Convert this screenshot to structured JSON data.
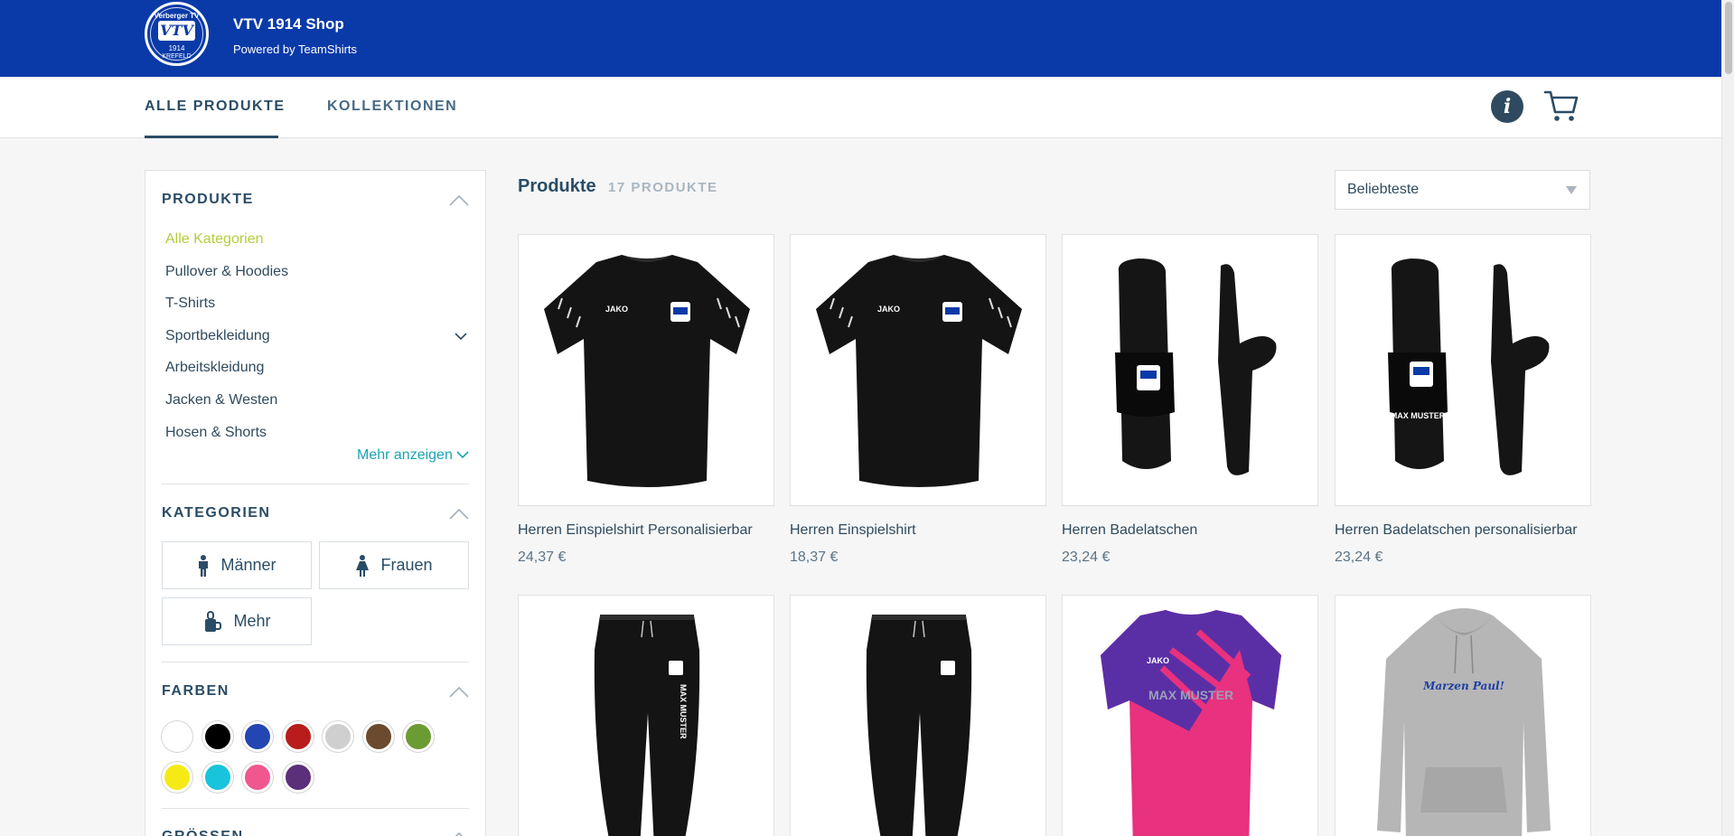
{
  "header": {
    "shop_title": "VTV 1914 Shop",
    "shop_subtitle": "Powered by TeamShirts",
    "logo": {
      "top_text": "Verberger TV",
      "mark": "VTV",
      "year": "1914",
      "city": "KREFELD"
    },
    "brand_color": "#0a3aa8"
  },
  "nav": {
    "tabs": [
      {
        "label": "ALLE PRODUKTE",
        "active": true
      },
      {
        "label": "KOLLEKTIONEN",
        "active": false
      }
    ],
    "icons": [
      "info-icon",
      "cart-icon"
    ]
  },
  "sidebar": {
    "produkte": {
      "title": "PRODUKTE",
      "items": [
        {
          "label": "Alle Kategorien",
          "active": true
        },
        {
          "label": "Pullover & Hoodies"
        },
        {
          "label": "T-Shirts"
        },
        {
          "label": "Sportbekleidung",
          "has_submenu": true
        },
        {
          "label": "Arbeitskleidung"
        },
        {
          "label": "Jacken & Westen"
        },
        {
          "label": "Hosen & Shorts"
        }
      ],
      "more_label": "Mehr anzeigen"
    },
    "kategorien": {
      "title": "KATEGORIEN",
      "buttons": [
        {
          "label": "Männer",
          "icon": "male-icon"
        },
        {
          "label": "Frauen",
          "icon": "female-icon"
        },
        {
          "label": "Mehr",
          "icon": "accessories-icon"
        }
      ]
    },
    "farben": {
      "title": "FARBEN",
      "swatches": [
        "#ffffff",
        "#000000",
        "#2346b2",
        "#b81c1c",
        "#cfcfcf",
        "#6b4a2e",
        "#6b9b33",
        "#f5ea16",
        "#18c3dc",
        "#f0578f",
        "#5b2f7a"
      ]
    },
    "groessen": {
      "title": "GRÖSSEN"
    }
  },
  "main": {
    "title": "Produkte",
    "count": "17 PRODUKTE",
    "sort": {
      "selected": "Beliebteste"
    },
    "products": [
      {
        "name": "Herren Einspielshirt Personalisierbar",
        "price": "24,37 €",
        "image": "black-jersey"
      },
      {
        "name": "Herren Einspielshirt",
        "price": "18,37 €",
        "image": "black-jersey"
      },
      {
        "name": "Herren Badelatschen",
        "price": "23,24 €",
        "image": "black-slides"
      },
      {
        "name": "Herren Badelatschen personalisierbar",
        "price": "23,24 €",
        "image": "black-slides-name",
        "print_text": "MAX MUSTER"
      },
      {
        "name": "",
        "price": "",
        "image": "black-pants-name",
        "print_text": "MAX MUSTER"
      },
      {
        "name": "",
        "price": "",
        "image": "black-pants"
      },
      {
        "name": "",
        "price": "",
        "image": "pink-purple-jersey",
        "print_text": "MAX MUSTER",
        "brand": "JAKO"
      },
      {
        "name": "",
        "price": "",
        "image": "grey-hoodie",
        "print_text": "Marzen Paul!"
      }
    ],
    "jersey_brand": "JAKO"
  }
}
